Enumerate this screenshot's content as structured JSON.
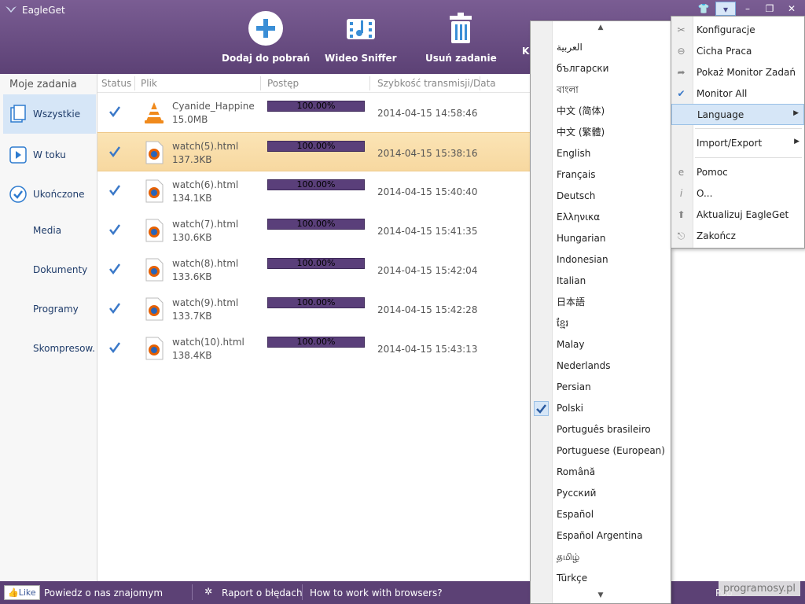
{
  "app": {
    "title": "EagleGet"
  },
  "toolbar": {
    "add_label": "Dodaj do pobrań",
    "sniffer_label": "Wideo Sniffer",
    "delete_label": "Usuń zadanie",
    "more_label": "K"
  },
  "window_controls": [
    "👕",
    "▾",
    "–",
    "❐",
    "✕"
  ],
  "sidebar": {
    "title": "Moje zadania",
    "items": [
      {
        "label": "Wszystkie"
      },
      {
        "label": "W toku"
      },
      {
        "label": "Ukończone"
      },
      {
        "label": "Media"
      },
      {
        "label": "Dokumenty"
      },
      {
        "label": "Programy"
      },
      {
        "label": "Skompresow..."
      }
    ]
  },
  "columns": {
    "status": "Status",
    "file": "Plik",
    "progress": "Postęp",
    "speed": "Szybkość transmisji/Data"
  },
  "rows": [
    {
      "name": "Cyanide_Happines:",
      "size": "15.0MB",
      "progress": "100.00%",
      "date": "2014-04-15 14:58:46",
      "icon": "vlc-icon"
    },
    {
      "name": "watch(5).html",
      "size": "137.3KB",
      "progress": "100.00%",
      "date": "2014-04-15 15:38:16",
      "icon": "firefox-icon"
    },
    {
      "name": "watch(6).html",
      "size": "134.1KB",
      "progress": "100.00%",
      "date": "2014-04-15 15:40:40",
      "icon": "firefox-icon"
    },
    {
      "name": "watch(7).html",
      "size": "130.6KB",
      "progress": "100.00%",
      "date": "2014-04-15 15:41:35",
      "icon": "firefox-icon"
    },
    {
      "name": "watch(8).html",
      "size": "133.6KB",
      "progress": "100.00%",
      "date": "2014-04-15 15:42:04",
      "icon": "firefox-icon"
    },
    {
      "name": "watch(9).html",
      "size": "133.7KB",
      "progress": "100.00%",
      "date": "2014-04-15 15:42:28",
      "icon": "firefox-icon"
    },
    {
      "name": "watch(10).html",
      "size": "138.4KB",
      "progress": "100.00%",
      "date": "2014-04-15 15:43:13",
      "icon": "firefox-icon"
    }
  ],
  "statusbar": {
    "like": "Like",
    "share": "Powiedz o nas znajomym",
    "report": "Raport o błędach",
    "howto": "How to work with browsers?",
    "right": "Pob",
    "watermark": "programosy.pl"
  },
  "languages": [
    "العربية",
    "български",
    "বাংলা",
    "中文 (简体)",
    "中文 (繁體)",
    "English",
    "Français",
    "Deutsch",
    "Ελληνικα",
    "Hungarian",
    "Indonesian",
    "Italian",
    "日本語",
    "ខ្មែរ",
    "Malay",
    "Nederlands",
    "Persian",
    "Polski",
    "Português brasileiro",
    "Portuguese (European)",
    "Română",
    "Русский",
    "Español",
    "Español Argentina",
    "தமிழ்",
    "Türkçe"
  ],
  "selected_language": "Polski",
  "main_menu": {
    "items": [
      {
        "label": "Konfiguracje",
        "icon": "tools-icon"
      },
      {
        "label": "Cicha Praca",
        "icon": "minus-circle-icon"
      },
      {
        "label": "Pokaż Monitor Zadań",
        "icon": "arrow-icon"
      },
      {
        "label": "Monitor All",
        "icon": "check-icon"
      },
      {
        "label": "Language",
        "icon": ""
      },
      {
        "label": "Import/Export",
        "icon": ""
      },
      {
        "label": "Pomoc",
        "icon": "help-e-icon"
      },
      {
        "label": "O...",
        "icon": "info-icon"
      },
      {
        "label": "Aktualizuj EagleGet",
        "icon": "update-icon"
      },
      {
        "label": "Zakończ",
        "icon": "exit-icon"
      }
    ]
  },
  "colors": {
    "header": "#5c4175",
    "progress": "#5a3f7a",
    "selected_row": "#fbe4b5",
    "accent": "#3a78c8"
  }
}
